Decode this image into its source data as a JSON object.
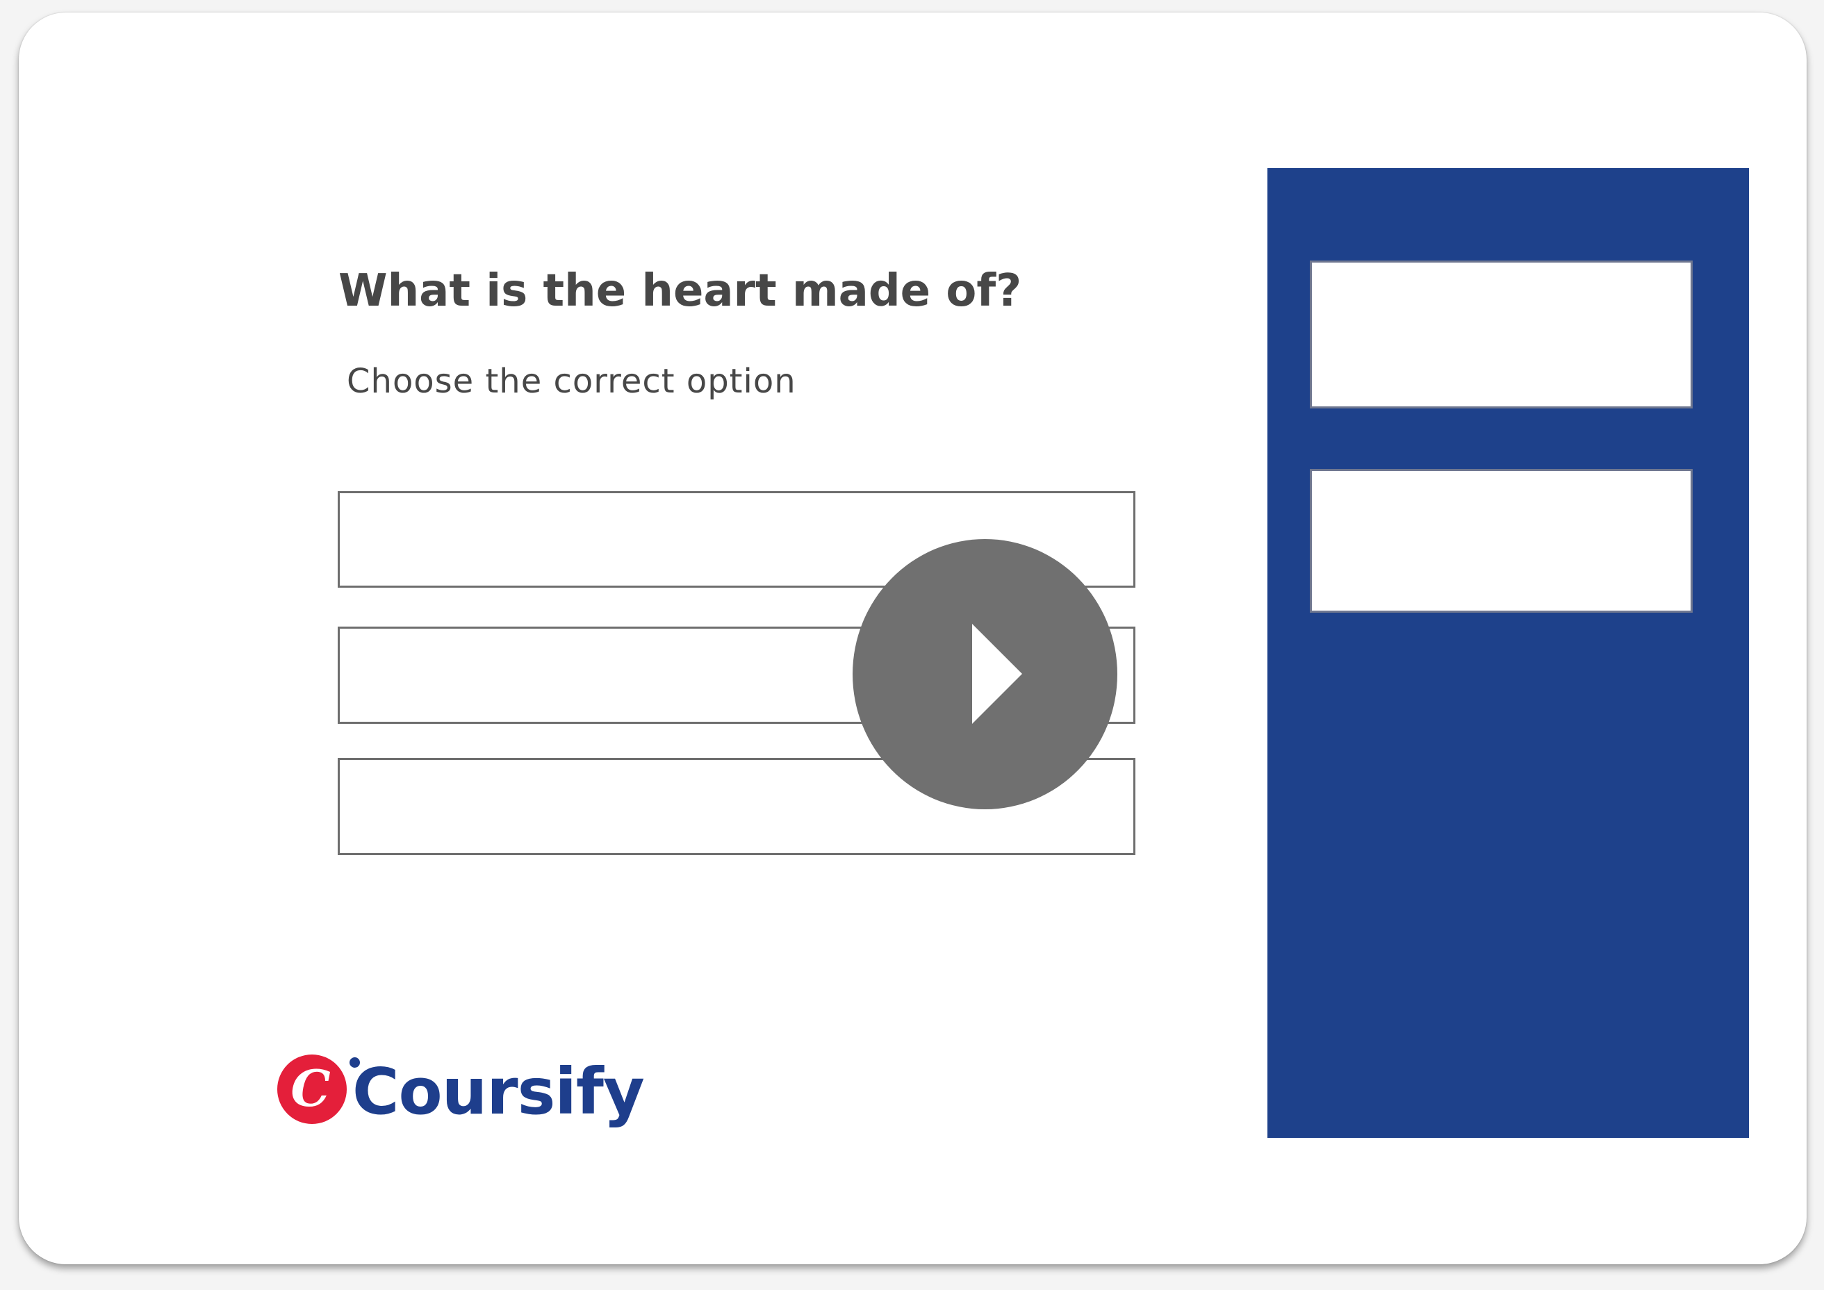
{
  "quiz": {
    "question": "What is the heart made of?",
    "instruction": "Choose the correct option",
    "options": [
      "",
      "",
      ""
    ]
  },
  "media": {
    "play_icon": "play-icon"
  },
  "side_panel": {
    "boxes": [
      "",
      ""
    ]
  },
  "brand": {
    "name": "Coursify",
    "mark_letter": "C",
    "logo_icon": "coursify-logo-icon"
  },
  "colors": {
    "panel_blue": "#1e418b",
    "brand_blue": "#1e3e8c",
    "brand_red": "#e41f3a",
    "play_gray": "#707070",
    "text_dark": "#474747"
  }
}
